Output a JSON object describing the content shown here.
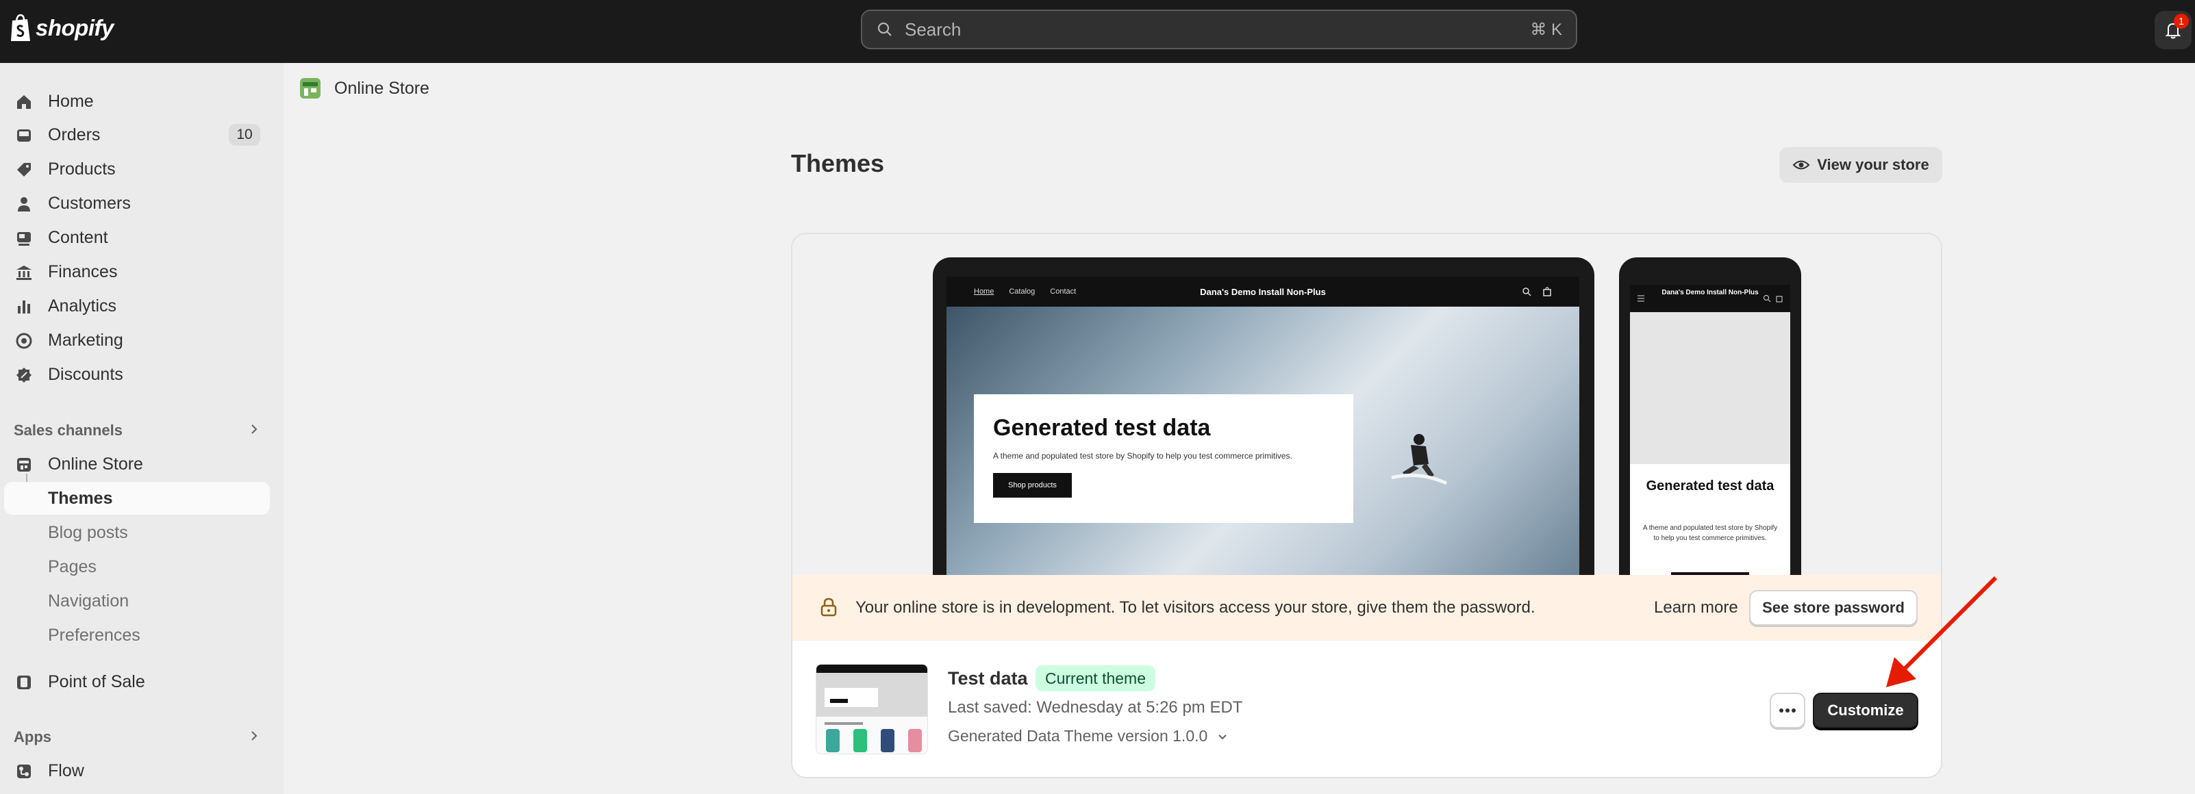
{
  "topbar": {
    "logo_text": "shopify",
    "search_placeholder": "Search",
    "search_shortcut": "⌘ K",
    "notification_count": "1"
  },
  "sidebar": {
    "items": [
      {
        "label": "Home",
        "icon": "home-icon"
      },
      {
        "label": "Orders",
        "icon": "inbox-icon",
        "count": "10"
      },
      {
        "label": "Products",
        "icon": "tag-icon"
      },
      {
        "label": "Customers",
        "icon": "person-icon"
      },
      {
        "label": "Content",
        "icon": "content-icon"
      },
      {
        "label": "Finances",
        "icon": "bank-icon"
      },
      {
        "label": "Analytics",
        "icon": "bar-chart-icon"
      },
      {
        "label": "Marketing",
        "icon": "target-icon"
      },
      {
        "label": "Discounts",
        "icon": "discount-icon"
      }
    ],
    "sales_channels_heading": "Sales channels",
    "online_store_label": "Online Store",
    "online_store_sub": [
      {
        "label": "Themes",
        "active": true
      },
      {
        "label": "Blog posts"
      },
      {
        "label": "Pages"
      },
      {
        "label": "Navigation"
      },
      {
        "label": "Preferences"
      }
    ],
    "point_of_sale_label": "Point of Sale",
    "apps_heading": "Apps",
    "flow_label": "Flow"
  },
  "breadcrumb": {
    "label": "Online Store"
  },
  "page": {
    "title": "Themes",
    "view_store_label": "View your store"
  },
  "preview": {
    "desktop": {
      "nav_links": [
        "Home",
        "Catalog",
        "Contact"
      ],
      "store_name": "Dana's Demo Install Non-Plus",
      "hero_heading": "Generated test data",
      "hero_text": "A theme and populated test store by Shopify to help you test commerce primitives.",
      "hero_button": "Shop products"
    },
    "mobile": {
      "store_name": "Dana's Demo Install Non-Plus",
      "hero_heading": "Generated test data",
      "hero_text": "A theme and populated test store by Shopify to help you test commerce primitives."
    }
  },
  "banner": {
    "message": "Your online store is in development. To let visitors access your store, give them the password.",
    "learn_more": "Learn more",
    "button": "See store password"
  },
  "theme": {
    "name": "Test data",
    "badge": "Current theme",
    "last_saved": "Last saved: Wednesday at 5:26 pm EDT",
    "version": "Generated Data Theme version 1.0.0",
    "customize_label": "Customize"
  },
  "colors": {
    "topbar": "#1a1a1a",
    "sidebar": "#ebebeb",
    "badge_bg": "#cdfee1",
    "banner_bg": "#fff1e3",
    "annotation_arrow": "#e51c00"
  }
}
